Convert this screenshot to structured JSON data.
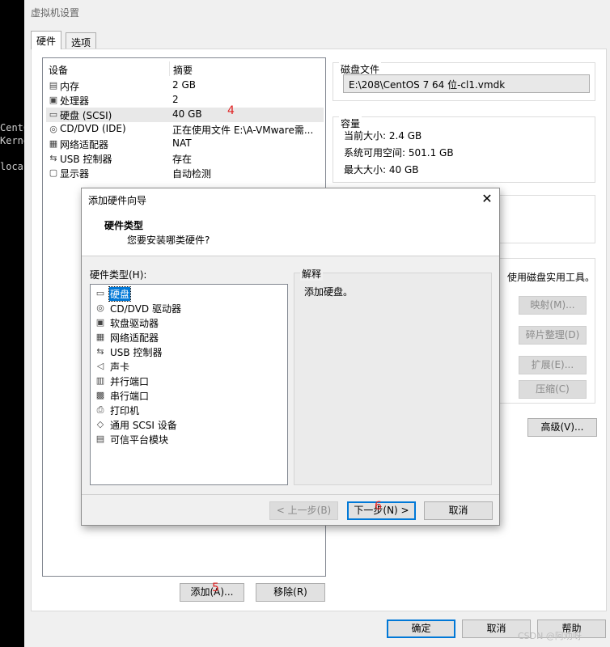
{
  "window": {
    "title": "虚拟机设置",
    "tabs": [
      {
        "label": "硬件"
      },
      {
        "label": "选项"
      }
    ]
  },
  "terminal": {
    "lines": [
      "CentC",
      "Kerne",
      "loca"
    ]
  },
  "device_list": {
    "col_device": "设备",
    "col_summary": "摘要",
    "rows": [
      {
        "icon": "memory-icon",
        "name": "内存",
        "summary": "2 GB"
      },
      {
        "icon": "processor-icon",
        "name": "处理器",
        "summary": "2"
      },
      {
        "icon": "harddisk-icon",
        "name": "硬盘 (SCSI)",
        "summary": "40 GB"
      },
      {
        "icon": "cd-dvd-icon",
        "name": "CD/DVD (IDE)",
        "summary": "正在使用文件 E:\\A-VMware需..."
      },
      {
        "icon": "network-adapter-icon",
        "name": "网络适配器",
        "summary": "NAT"
      },
      {
        "icon": "usb-icon",
        "name": "USB 控制器",
        "summary": "存在"
      },
      {
        "icon": "display-icon",
        "name": "显示器",
        "summary": "自动检测"
      }
    ]
  },
  "annotations": {
    "step4": "4",
    "step5": "5",
    "step6": "6"
  },
  "disk_file": {
    "title": "磁盘文件",
    "path": "E:\\208\\CentOS 7 64 位-cl1.vmdk"
  },
  "capacity": {
    "title": "容量",
    "current": "当前大小: 2.4 GB",
    "free": "系统可用空间: 501.1 GB",
    "max": "最大大小: 40 GB"
  },
  "disk_util": {
    "text_fragment": "使用磁盘实用工具。",
    "map": "映射(M)...",
    "defrag": "碎片整理(D)",
    "expand": "扩展(E)...",
    "compact": "压缩(C)"
  },
  "advanced_btn": "高级(V)...",
  "add_btn": "添加(A)...",
  "remove_btn": "移除(R)",
  "footer": {
    "ok": "确定",
    "cancel": "取消",
    "help": "帮助"
  },
  "watermark": "CSDN @阿劝呀",
  "wizard": {
    "title": "添加硬件向导",
    "header_title": "硬件类型",
    "header_sub": "您要安装哪类硬件?",
    "list_label": "硬件类型(H):",
    "items": [
      {
        "icon": "harddisk-icon",
        "name": "硬盘"
      },
      {
        "icon": "cd-dvd-icon",
        "name": "CD/DVD 驱动器"
      },
      {
        "icon": "floppy-icon",
        "name": "软盘驱动器"
      },
      {
        "icon": "network-adapter-icon",
        "name": "网络适配器"
      },
      {
        "icon": "usb-icon",
        "name": "USB 控制器"
      },
      {
        "icon": "sound-card-icon",
        "name": "声卡"
      },
      {
        "icon": "parallel-port-icon",
        "name": "并行端口"
      },
      {
        "icon": "serial-port-icon",
        "name": "串行端口"
      },
      {
        "icon": "printer-icon",
        "name": "打印机"
      },
      {
        "icon": "scsi-device-icon",
        "name": "通用 SCSI 设备"
      },
      {
        "icon": "tpm-icon",
        "name": "可信平台模块"
      }
    ],
    "explain_title": "解释",
    "explain_text": "添加硬盘。",
    "back": "< 上一步(B)",
    "next": "下一步(N) >",
    "cancel": "取消"
  }
}
